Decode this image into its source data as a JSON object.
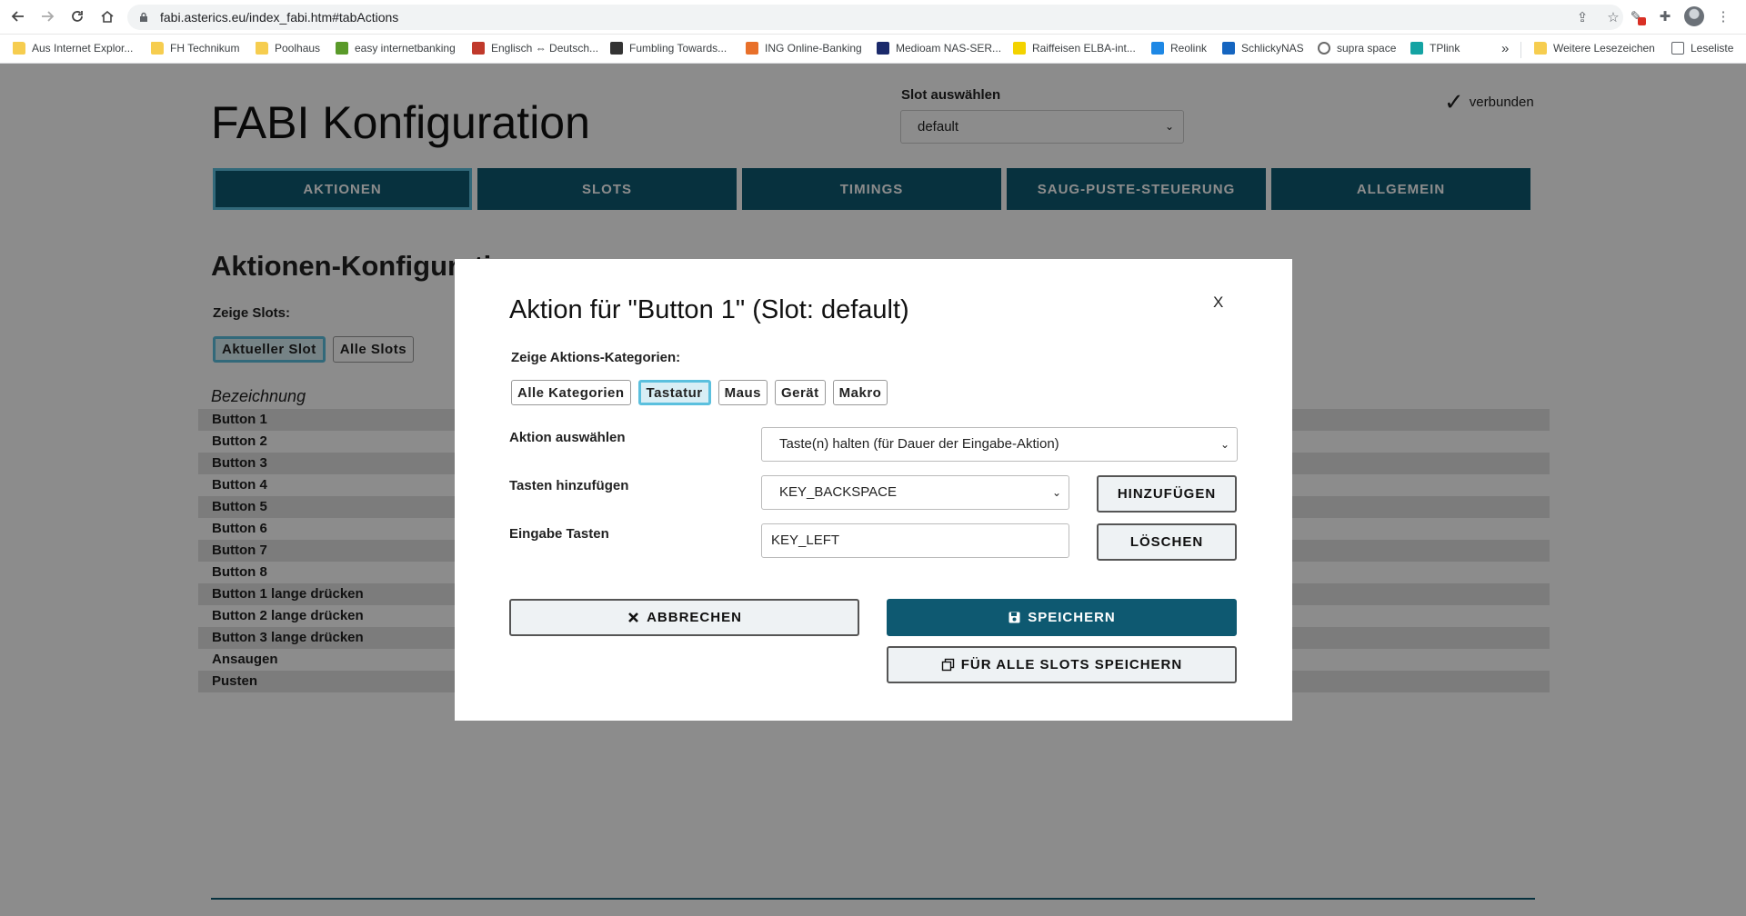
{
  "browser": {
    "url": "fabi.asterics.eu/index_fabi.htm#tabActions",
    "bookmarks": [
      {
        "label": "Aus Internet Explor...",
        "color": "#f6cd4f",
        "icon": "folder-icon"
      },
      {
        "label": "FH Technikum",
        "color": "#f6cd4f",
        "icon": "folder-icon"
      },
      {
        "label": "Poolhaus",
        "color": "#f6cd4f",
        "icon": "folder-icon"
      },
      {
        "label": "easy internetbanking",
        "color": "#5a9a2a",
        "icon": "bank-icon"
      },
      {
        "label": "Englisch ⇔ Deutsch...",
        "color": "#c0392b",
        "icon": "dictionary-icon"
      },
      {
        "label": "Fumbling Towards...",
        "color": "#333333",
        "icon": "blog-icon"
      },
      {
        "label": "ING Online-Banking",
        "color": "#e8702a",
        "icon": "ing-icon"
      },
      {
        "label": "Medioam NAS-SER...",
        "color": "#1b2a6b",
        "icon": "nas-icon"
      },
      {
        "label": "Raiffeisen ELBA-int...",
        "color": "#f3d300",
        "icon": "raiffeisen-icon"
      },
      {
        "label": "Reolink",
        "color": "#1e88e5",
        "icon": "reolink-icon"
      },
      {
        "label": "SchlickyNAS",
        "color": "#1565c0",
        "icon": "nas-icon"
      },
      {
        "label": "supra space",
        "color": "#555555",
        "icon": "globe-icon"
      },
      {
        "label": "TPlink",
        "color": "#14a3a3",
        "icon": "tplink-icon"
      }
    ],
    "more_bookmarks": "»",
    "other_bookmarks": "Weitere Lesezeichen",
    "reading_list": "Leseliste"
  },
  "page": {
    "title": "FABI Konfiguration",
    "slot_label": "Slot auswählen",
    "slot_value": "default",
    "connection_status": "verbunden",
    "tabs": [
      {
        "label": "AKTIONEN",
        "active": true
      },
      {
        "label": "SLOTS",
        "active": false
      },
      {
        "label": "TIMINGS",
        "active": false
      },
      {
        "label": "SAUG-PUSTE-STEUERUNG",
        "active": false
      },
      {
        "label": "ALLGEMEIN",
        "active": false
      }
    ],
    "section_title": "Aktionen-Konfigurati",
    "show_slots_label": "Zeige Slots:",
    "slot_buttons": [
      "Aktueller Slot",
      "Alle Slots"
    ],
    "column_header": "Bezeichnung",
    "buttons": [
      "Button 1",
      "Button 2",
      "Button 3",
      "Button 4",
      "Button 5",
      "Button 6",
      "Button 7",
      "Button 8",
      "Button 1 lange drücken",
      "Button 2 lange drücken",
      "Button 3 lange drücken",
      "Ansaugen",
      "Pusten"
    ]
  },
  "modal": {
    "title": "Aktion für \"Button 1\" (Slot: default)",
    "close": "X",
    "category_label": "Zeige Aktions-Kategorien:",
    "categories": [
      {
        "label": "Alle Kategorien",
        "active": false
      },
      {
        "label": "Tastatur",
        "active": true
      },
      {
        "label": "Maus",
        "active": false
      },
      {
        "label": "Gerät",
        "active": false
      },
      {
        "label": "Makro",
        "active": false
      }
    ],
    "action_label": "Aktion auswählen",
    "action_value": "Taste(n) halten (für Dauer der Eingabe-Aktion)",
    "add_keys_label": "Tasten hinzufügen",
    "add_keys_value": "KEY_BACKSPACE",
    "add_button": "HINZUFÜGEN",
    "input_keys_label": "Eingabe Tasten",
    "input_keys_value": "KEY_LEFT",
    "delete_button": "LÖSCHEN",
    "cancel_button": "ABBRECHEN",
    "save_button": "SPEICHERN",
    "save_all_button": "FÜR ALLE SLOTS SPEICHERN"
  }
}
